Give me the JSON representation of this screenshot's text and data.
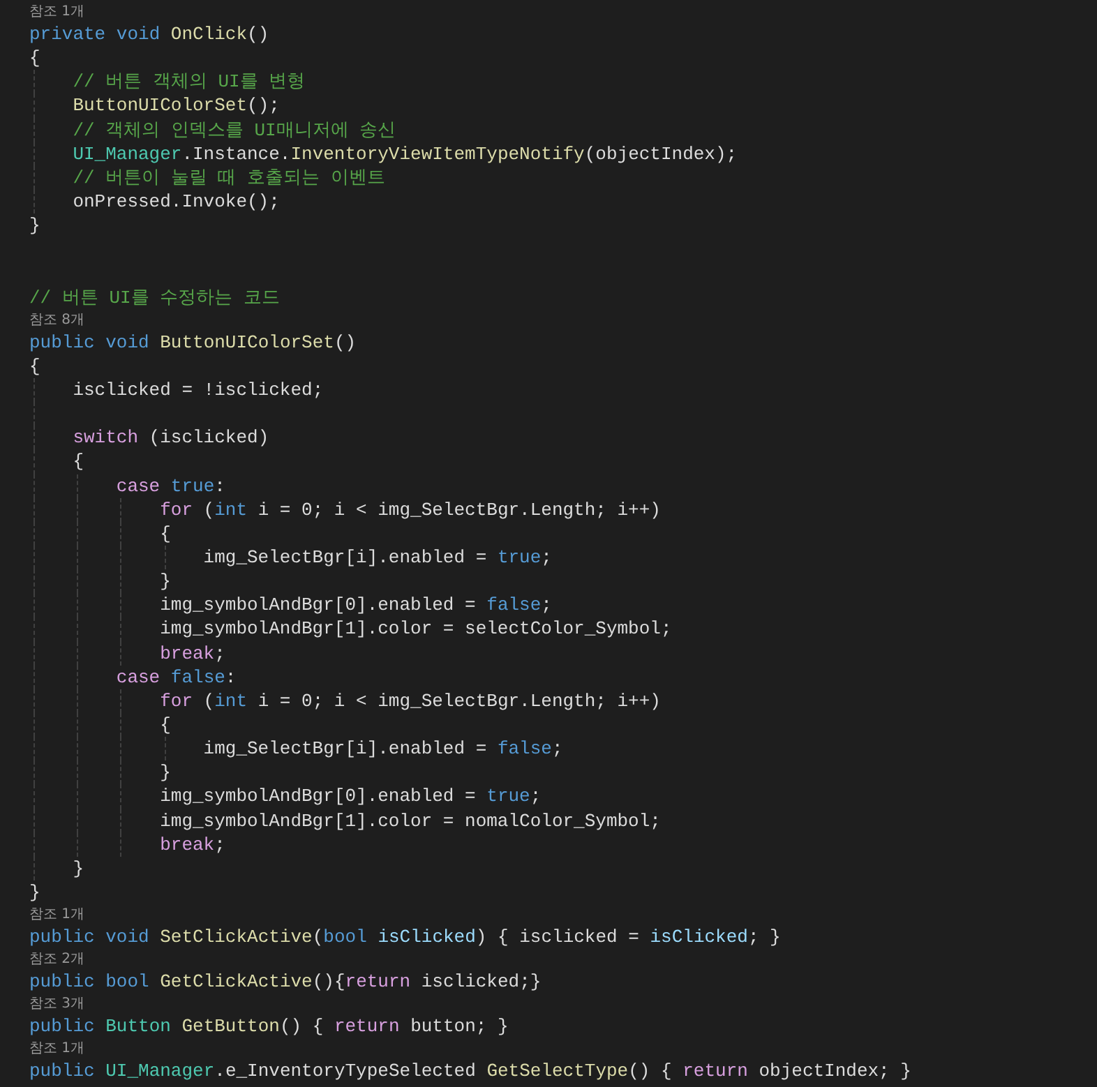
{
  "editor": {
    "lines": [
      {
        "kind": "lens",
        "text": "참조 1개"
      },
      {
        "kind": "code",
        "tokens": [
          {
            "kind": "keyword",
            "text": "private void"
          },
          {
            "kind": "method",
            "text": " OnClick"
          },
          {
            "kind": "plain",
            "text": "()"
          }
        ]
      },
      {
        "kind": "code",
        "tokens": [
          {
            "kind": "plain",
            "text": "{"
          }
        ]
      },
      {
        "kind": "code",
        "tokens": [
          {
            "kind": "comment",
            "text": "    // 버튼 객체의 UI를 변형"
          }
        ]
      },
      {
        "kind": "code",
        "tokens": [
          {
            "kind": "method",
            "text": "    ButtonUIColorSet"
          },
          {
            "kind": "plain",
            "text": "();"
          }
        ]
      },
      {
        "kind": "code",
        "tokens": [
          {
            "kind": "comment",
            "text": "    // 객체의 인덱스를 UI매니저에 송신"
          }
        ]
      },
      {
        "kind": "code",
        "tokens": [
          {
            "kind": "type",
            "text": "    UI_Manager"
          },
          {
            "kind": "plain",
            "text": ".Instance."
          },
          {
            "kind": "method",
            "text": "InventoryViewItemTypeNotify"
          },
          {
            "kind": "plain",
            "text": "(objectIndex);"
          }
        ]
      },
      {
        "kind": "code",
        "tokens": [
          {
            "kind": "comment",
            "text": "    // 버튼이 눌릴 때 호출되는 이벤트"
          }
        ]
      },
      {
        "kind": "code",
        "tokens": [
          {
            "kind": "plain",
            "text": "    onPressed.Invoke();"
          }
        ]
      },
      {
        "kind": "code",
        "tokens": [
          {
            "kind": "plain",
            "text": "}"
          }
        ]
      },
      {
        "kind": "blank"
      },
      {
        "kind": "blank"
      },
      {
        "kind": "code",
        "tokens": [
          {
            "kind": "comment",
            "text": "// 버튼 UI를 수정하는 코드"
          }
        ]
      },
      {
        "kind": "lens",
        "text": "참조 8개"
      },
      {
        "kind": "code",
        "tokens": [
          {
            "kind": "keyword",
            "text": "public void"
          },
          {
            "kind": "method",
            "text": " ButtonUIColorSet"
          },
          {
            "kind": "plain",
            "text": "()"
          }
        ]
      },
      {
        "kind": "code",
        "tokens": [
          {
            "kind": "plain",
            "text": "{"
          }
        ]
      },
      {
        "kind": "code",
        "tokens": [
          {
            "kind": "plain",
            "text": "    isclicked = !isclicked;"
          }
        ]
      },
      {
        "kind": "blank"
      },
      {
        "kind": "code",
        "tokens": [
          {
            "kind": "control",
            "text": "    switch"
          },
          {
            "kind": "plain",
            "text": " (isclicked)"
          }
        ]
      },
      {
        "kind": "code",
        "tokens": [
          {
            "kind": "plain",
            "text": "    {"
          }
        ]
      },
      {
        "kind": "code",
        "tokens": [
          {
            "kind": "control",
            "text": "        case"
          },
          {
            "kind": "keyword",
            "text": " true"
          },
          {
            "kind": "plain",
            "text": ":"
          }
        ]
      },
      {
        "kind": "code",
        "tokens": [
          {
            "kind": "control",
            "text": "            for"
          },
          {
            "kind": "plain",
            "text": " ("
          },
          {
            "kind": "keyword",
            "text": "int"
          },
          {
            "kind": "plain",
            "text": " i = 0; i < img_SelectBgr.Length; i++)"
          }
        ]
      },
      {
        "kind": "code",
        "tokens": [
          {
            "kind": "plain",
            "text": "            {"
          }
        ]
      },
      {
        "kind": "code",
        "tokens": [
          {
            "kind": "plain",
            "text": "                img_SelectBgr[i].enabled = "
          },
          {
            "kind": "keyword",
            "text": "true"
          },
          {
            "kind": "plain",
            "text": ";"
          }
        ]
      },
      {
        "kind": "code",
        "tokens": [
          {
            "kind": "plain",
            "text": "            }"
          }
        ]
      },
      {
        "kind": "code",
        "tokens": [
          {
            "kind": "plain",
            "text": "            img_symbolAndBgr[0].enabled = "
          },
          {
            "kind": "keyword",
            "text": "false"
          },
          {
            "kind": "plain",
            "text": ";"
          }
        ]
      },
      {
        "kind": "code",
        "tokens": [
          {
            "kind": "plain",
            "text": "            img_symbolAndBgr[1].color = selectColor_Symbol;"
          }
        ]
      },
      {
        "kind": "code",
        "tokens": [
          {
            "kind": "control",
            "text": "            break"
          },
          {
            "kind": "plain",
            "text": ";"
          }
        ]
      },
      {
        "kind": "code",
        "tokens": [
          {
            "kind": "control",
            "text": "        case"
          },
          {
            "kind": "keyword",
            "text": " false"
          },
          {
            "kind": "plain",
            "text": ":"
          }
        ]
      },
      {
        "kind": "code",
        "tokens": [
          {
            "kind": "control",
            "text": "            for"
          },
          {
            "kind": "plain",
            "text": " ("
          },
          {
            "kind": "keyword",
            "text": "int"
          },
          {
            "kind": "plain",
            "text": " i = 0; i < img_SelectBgr.Length; i++)"
          }
        ]
      },
      {
        "kind": "code",
        "tokens": [
          {
            "kind": "plain",
            "text": "            {"
          }
        ]
      },
      {
        "kind": "code",
        "tokens": [
          {
            "kind": "plain",
            "text": "                img_SelectBgr[i].enabled = "
          },
          {
            "kind": "keyword",
            "text": "false"
          },
          {
            "kind": "plain",
            "text": ";"
          }
        ]
      },
      {
        "kind": "code",
        "tokens": [
          {
            "kind": "plain",
            "text": "            }"
          }
        ]
      },
      {
        "kind": "code",
        "tokens": [
          {
            "kind": "plain",
            "text": "            img_symbolAndBgr[0].enabled = "
          },
          {
            "kind": "keyword",
            "text": "true"
          },
          {
            "kind": "plain",
            "text": ";"
          }
        ]
      },
      {
        "kind": "code",
        "tokens": [
          {
            "kind": "plain",
            "text": "            img_symbolAndBgr[1].color = nomalColor_Symbol;"
          }
        ]
      },
      {
        "kind": "code",
        "tokens": [
          {
            "kind": "control",
            "text": "            break"
          },
          {
            "kind": "plain",
            "text": ";"
          }
        ]
      },
      {
        "kind": "code",
        "tokens": [
          {
            "kind": "plain",
            "text": "    }"
          }
        ]
      },
      {
        "kind": "code",
        "tokens": [
          {
            "kind": "plain",
            "text": "}"
          }
        ]
      },
      {
        "kind": "lens",
        "text": "참조 1개"
      },
      {
        "kind": "code",
        "tokens": [
          {
            "kind": "keyword",
            "text": "public void"
          },
          {
            "kind": "method",
            "text": " SetClickActive"
          },
          {
            "kind": "plain",
            "text": "("
          },
          {
            "kind": "keyword",
            "text": "bool"
          },
          {
            "kind": "param",
            "text": " isClicked"
          },
          {
            "kind": "plain",
            "text": ") { isclicked = "
          },
          {
            "kind": "param",
            "text": "isClicked"
          },
          {
            "kind": "plain",
            "text": "; }"
          }
        ]
      },
      {
        "kind": "lens",
        "text": "참조 2개"
      },
      {
        "kind": "code",
        "tokens": [
          {
            "kind": "keyword",
            "text": "public bool"
          },
          {
            "kind": "method",
            "text": " GetClickActive"
          },
          {
            "kind": "plain",
            "text": "(){"
          },
          {
            "kind": "control",
            "text": "return"
          },
          {
            "kind": "plain",
            "text": " isclicked;}"
          }
        ]
      },
      {
        "kind": "lens",
        "text": "참조 3개"
      },
      {
        "kind": "code",
        "tokens": [
          {
            "kind": "keyword",
            "text": "public"
          },
          {
            "kind": "type",
            "text": " Button"
          },
          {
            "kind": "method",
            "text": " GetButton"
          },
          {
            "kind": "plain",
            "text": "() { "
          },
          {
            "kind": "control",
            "text": "return"
          },
          {
            "kind": "plain",
            "text": " button; }"
          }
        ]
      },
      {
        "kind": "lens",
        "text": "참조 1개"
      },
      {
        "kind": "code",
        "tokens": [
          {
            "kind": "keyword",
            "text": "public"
          },
          {
            "kind": "type",
            "text": " UI_Manager"
          },
          {
            "kind": "plain",
            "text": ".e_InventoryTypeSelected "
          },
          {
            "kind": "method",
            "text": "GetSelectType"
          },
          {
            "kind": "plain",
            "text": "() { "
          },
          {
            "kind": "control",
            "text": "return"
          },
          {
            "kind": "plain",
            "text": " objectIndex; }"
          }
        ]
      }
    ]
  }
}
